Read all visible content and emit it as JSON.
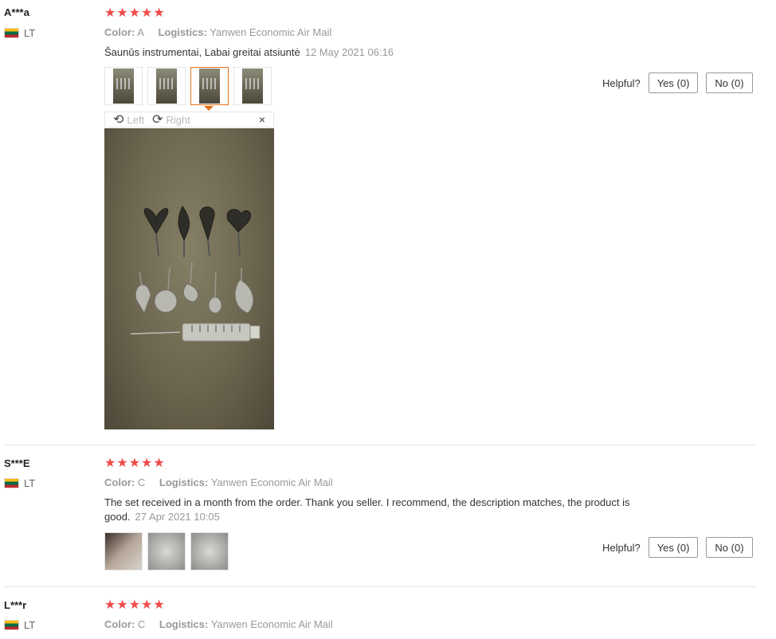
{
  "reviews": [
    {
      "user": "A***a",
      "country": "LT",
      "rating": 5,
      "color_label": "Color:",
      "color_value": "A",
      "logistics_label": "Logistics:",
      "logistics_value": "Yanwen Economic Air Mail",
      "text": "Šaunūs instrumentai, Labai greitai atsiuntė",
      "date": "12 May 2021 06:16",
      "helpful_label": "Helpful?",
      "yes_label": "Yes (0)",
      "no_label": "No (0)",
      "viewer": {
        "left_label": "Left",
        "right_label": "Right",
        "close_glyph": "×"
      }
    },
    {
      "user": "S***E",
      "country": "LT",
      "rating": 5,
      "color_label": "Color:",
      "color_value": "C",
      "logistics_label": "Logistics:",
      "logistics_value": "Yanwen Economic Air Mail",
      "text": "The set received in a month from the order. Thank you seller. I recommend, the description matches, the product is good.",
      "date": "27 Apr 2021 10:05",
      "helpful_label": "Helpful?",
      "yes_label": "Yes (0)",
      "no_label": "No (0)"
    },
    {
      "user": "L***r",
      "country": "LT",
      "rating": 5,
      "color_label": "Color:",
      "color_value": "C",
      "logistics_label": "Logistics:",
      "logistics_value": "Yanwen Economic Air Mail"
    }
  ],
  "icons": {
    "star": "★",
    "rotate_left": "⟲",
    "rotate_right": "⟳"
  },
  "colors": {
    "star": "#f04a4a",
    "active_thumb": "#e2701c"
  }
}
